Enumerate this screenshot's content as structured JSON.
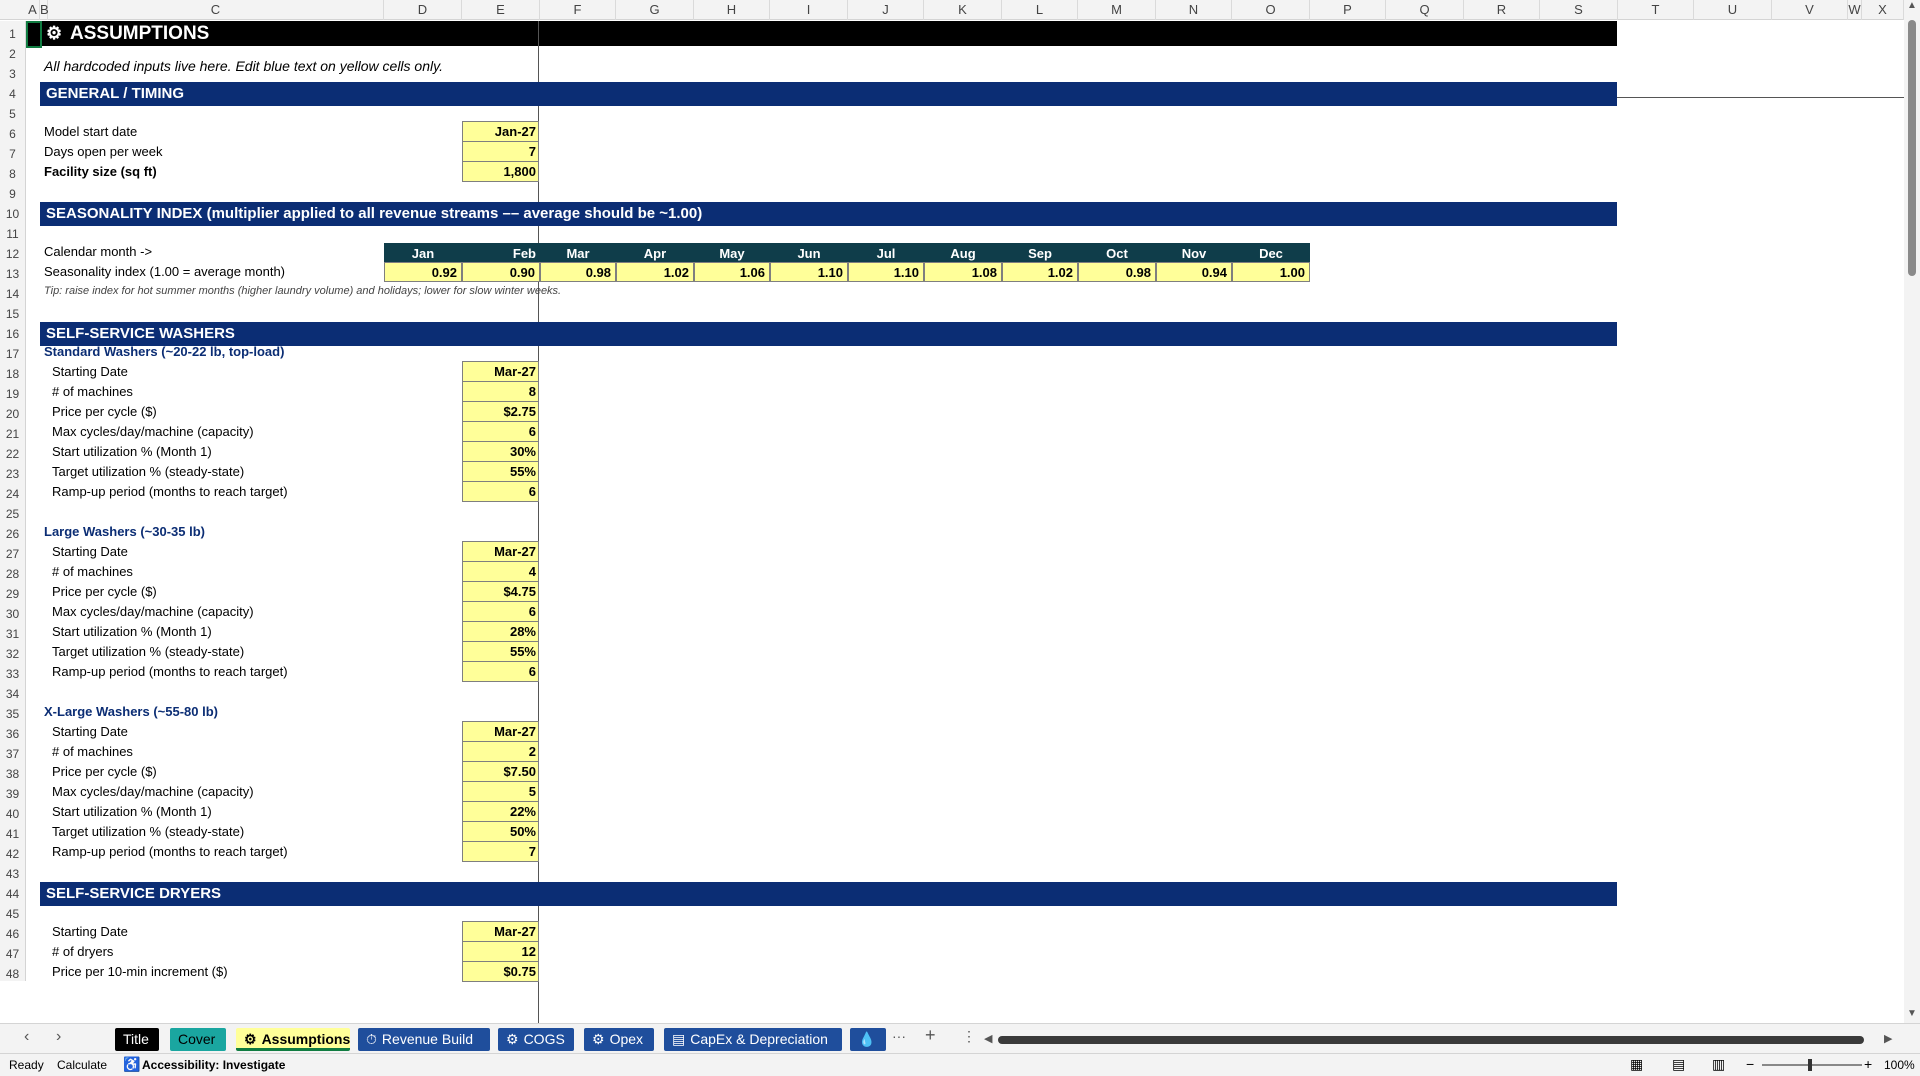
{
  "columns": [
    "A",
    "B",
    "C",
    "D",
    "E",
    "F",
    "G",
    "H",
    "I",
    "J",
    "K",
    "L",
    "M",
    "N",
    "O",
    "P",
    "Q",
    "R",
    "S",
    "T",
    "U",
    "V",
    "W",
    "X"
  ],
  "rows": [
    "1",
    "2",
    "3",
    "4",
    "5",
    "6",
    "7",
    "8",
    "9",
    "10",
    "11",
    "12",
    "13",
    "14",
    "15",
    "16",
    "17",
    "18",
    "19",
    "20",
    "21",
    "22",
    "23",
    "24",
    "25",
    "26",
    "27",
    "28",
    "29",
    "30",
    "31",
    "32",
    "33",
    "34",
    "35",
    "36",
    "37",
    "38",
    "39",
    "40",
    "41",
    "42",
    "43",
    "44",
    "45",
    "46",
    "47",
    "48"
  ],
  "title": {
    "icon": "gear-icon",
    "text": "ASSUMPTIONS"
  },
  "subtitle": "All hardcoded inputs live here. Edit blue text on yellow cells only.",
  "general": {
    "header": "GENERAL / TIMING",
    "rows": [
      {
        "label": "Model start date",
        "value": "Jan-27"
      },
      {
        "label": "Days open per week",
        "value": "7"
      },
      {
        "label": "Facility size (sq ft)",
        "value": "1,800"
      }
    ]
  },
  "seasonality": {
    "header": "SEASONALITY INDEX  (multiplier applied to all revenue streams –– average should be ~1.00)",
    "month_label": "Calendar month ->",
    "index_label": "Seasonality index (1.00 = average month)",
    "months": [
      "Jan",
      "Feb",
      "Mar",
      "Apr",
      "May",
      "Jun",
      "Jul",
      "Aug",
      "Sep",
      "Oct",
      "Nov",
      "Dec"
    ],
    "values": [
      "0.92",
      "0.90",
      "0.98",
      "1.02",
      "1.06",
      "1.10",
      "1.10",
      "1.08",
      "1.02",
      "0.98",
      "0.94",
      "1.00"
    ],
    "tip": "Tip: raise index for hot summer months (higher laundry volume) and holidays; lower for slow winter weeks."
  },
  "washers": {
    "header": "SELF-SERVICE WASHERS",
    "groups": [
      {
        "title": "Standard Washers (~20-22 lb, top-load)",
        "rows": [
          {
            "label": "Starting Date",
            "value": "Mar-27"
          },
          {
            "label": "# of machines",
            "value": "8"
          },
          {
            "label": "Price per cycle ($)",
            "value": "$2.75"
          },
          {
            "label": "Max cycles/day/machine (capacity)",
            "value": "6"
          },
          {
            "label": "Start utilization % (Month 1)",
            "value": "30%"
          },
          {
            "label": "Target utilization % (steady-state)",
            "value": "55%"
          },
          {
            "label": "Ramp-up period (months to reach target)",
            "value": "6"
          }
        ]
      },
      {
        "title": "Large Washers (~30-35 lb)",
        "rows": [
          {
            "label": "Starting Date",
            "value": "Mar-27"
          },
          {
            "label": "# of machines",
            "value": "4"
          },
          {
            "label": "Price per cycle ($)",
            "value": "$4.75"
          },
          {
            "label": "Max cycles/day/machine (capacity)",
            "value": "6"
          },
          {
            "label": "Start utilization % (Month 1)",
            "value": "28%"
          },
          {
            "label": "Target utilization % (steady-state)",
            "value": "55%"
          },
          {
            "label": "Ramp-up period (months to reach target)",
            "value": "6"
          }
        ]
      },
      {
        "title": "X-Large Washers (~55-80 lb)",
        "rows": [
          {
            "label": "Starting Date",
            "value": "Mar-27"
          },
          {
            "label": "# of machines",
            "value": "2"
          },
          {
            "label": "Price per cycle ($)",
            "value": "$7.50"
          },
          {
            "label": "Max cycles/day/machine (capacity)",
            "value": "5"
          },
          {
            "label": "Start utilization % (Month 1)",
            "value": "22%"
          },
          {
            "label": "Target utilization % (steady-state)",
            "value": "50%"
          },
          {
            "label": "Ramp-up period (months to reach target)",
            "value": "7"
          }
        ]
      }
    ]
  },
  "dryers": {
    "header": "SELF-SERVICE DRYERS",
    "rows": [
      {
        "label": "Starting Date",
        "value": "Mar-27"
      },
      {
        "label": "# of dryers",
        "value": "12"
      },
      {
        "label": "Price per 10-min increment ($)",
        "value": "$0.75"
      }
    ]
  },
  "tabs": [
    {
      "label": "Title",
      "bg": "#000000",
      "fg": "#ffffff",
      "icon": ""
    },
    {
      "label": "Cover",
      "bg": "#1aa6a0",
      "fg": "#000000",
      "icon": ""
    },
    {
      "label": "Assumptions",
      "bg": "#ffff99",
      "fg": "#000000",
      "icon": "gear-icon",
      "active": true
    },
    {
      "label": "Revenue Build",
      "bg": "#1f4e9c",
      "fg": "#ffffff",
      "icon": "stopwatch-icon"
    },
    {
      "label": "COGS",
      "bg": "#1f4e9c",
      "fg": "#ffffff",
      "icon": "gear-icon"
    },
    {
      "label": "Opex",
      "bg": "#1f4e9c",
      "fg": "#ffffff",
      "icon": "gear-icon"
    },
    {
      "label": "CapEx & Depreciation",
      "bg": "#1f4e9c",
      "fg": "#ffffff",
      "icon": "doc-icon"
    },
    {
      "label": "",
      "bg": "#1f4e9c",
      "fg": "#ffffff",
      "icon": "drop-icon"
    }
  ],
  "tab_more": "···",
  "tab_add": "+",
  "tab_menu": "⋮",
  "status": {
    "ready": "Ready",
    "calculate": "Calculate",
    "accessibility": "Accessibility: Investigate",
    "zoom": "100%",
    "zoom_minus": "−",
    "zoom_plus": "+"
  },
  "colors": {
    "banner": "#0b2d74",
    "input_fill": "#ffff99",
    "month_header": "#0f3d4a"
  }
}
